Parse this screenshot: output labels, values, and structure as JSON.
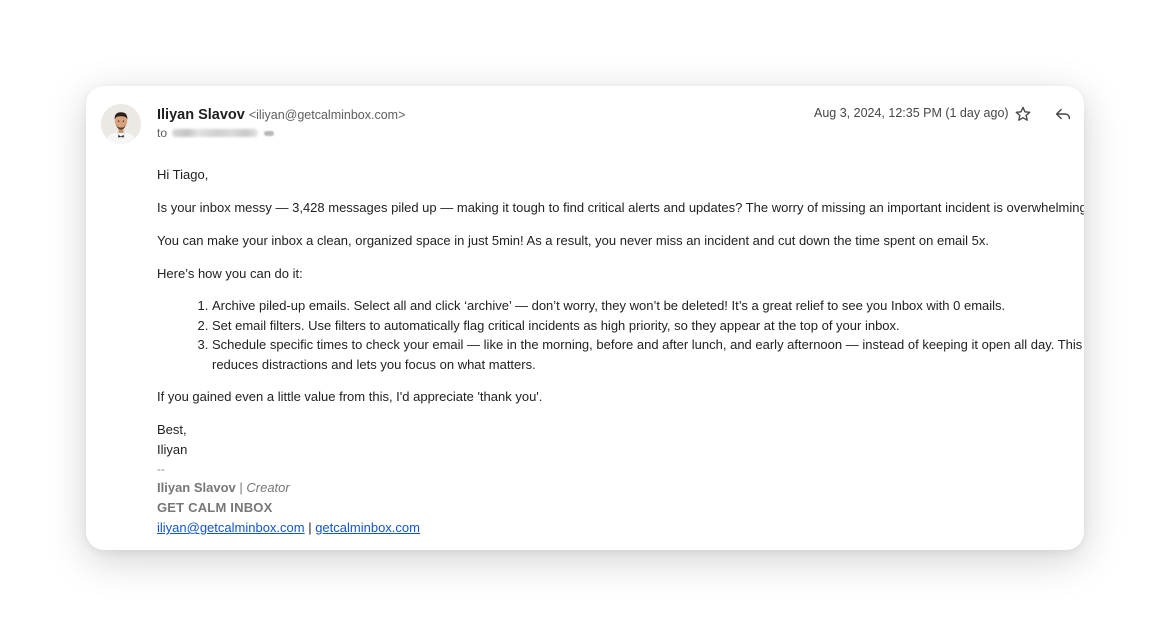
{
  "email": {
    "sender_name": "Iliyan Slavov",
    "sender_email": "<iliyan@getcalminbox.com>",
    "to_prefix": "to",
    "date": "Aug 3, 2024, 12:35 PM (1 day ago)",
    "actions": {
      "star_icon": "star-icon",
      "reply_icon": "reply-icon"
    },
    "body": {
      "greeting": "Hi Tiago,",
      "para1": "Is your inbox messy — 3,428 messages piled up — making it tough to find critical alerts and updates? The worry of missing an important incident is overwhelming.",
      "para2": "You can make your inbox a clean, organized space in just 5min! As a result, you never miss an incident and cut down the time spent on email 5x.",
      "para3": "Here’s how you can do it:",
      "steps": [
        "Archive piled-up emails. Select all and click ‘archive’ — don’t worry, they won’t be deleted! It’s a great relief to see you Inbox with 0 emails.",
        "Set email filters. Use filters to automatically flag critical incidents as high priority, so they appear at the top of your inbox.",
        "Schedule specific times to check your email — like in the morning, before and after lunch, and early afternoon — instead of keeping it open all day. This",
        "reduces distractions and lets you focus on what matters."
      ],
      "para4": "If you gained even a little value from this, I'd appreciate 'thank you'.",
      "closing": "Best,",
      "closing_name": "Iliyan"
    },
    "signature": {
      "dash": "--",
      "name": "Iliyan Slavov",
      "separator": " | ",
      "role": "Creator",
      "company": "GET CALM INBOX",
      "email_link": "iliyan@getcalminbox.com",
      "link_separator": " | ",
      "site_link": "getcalminbox.com"
    }
  }
}
